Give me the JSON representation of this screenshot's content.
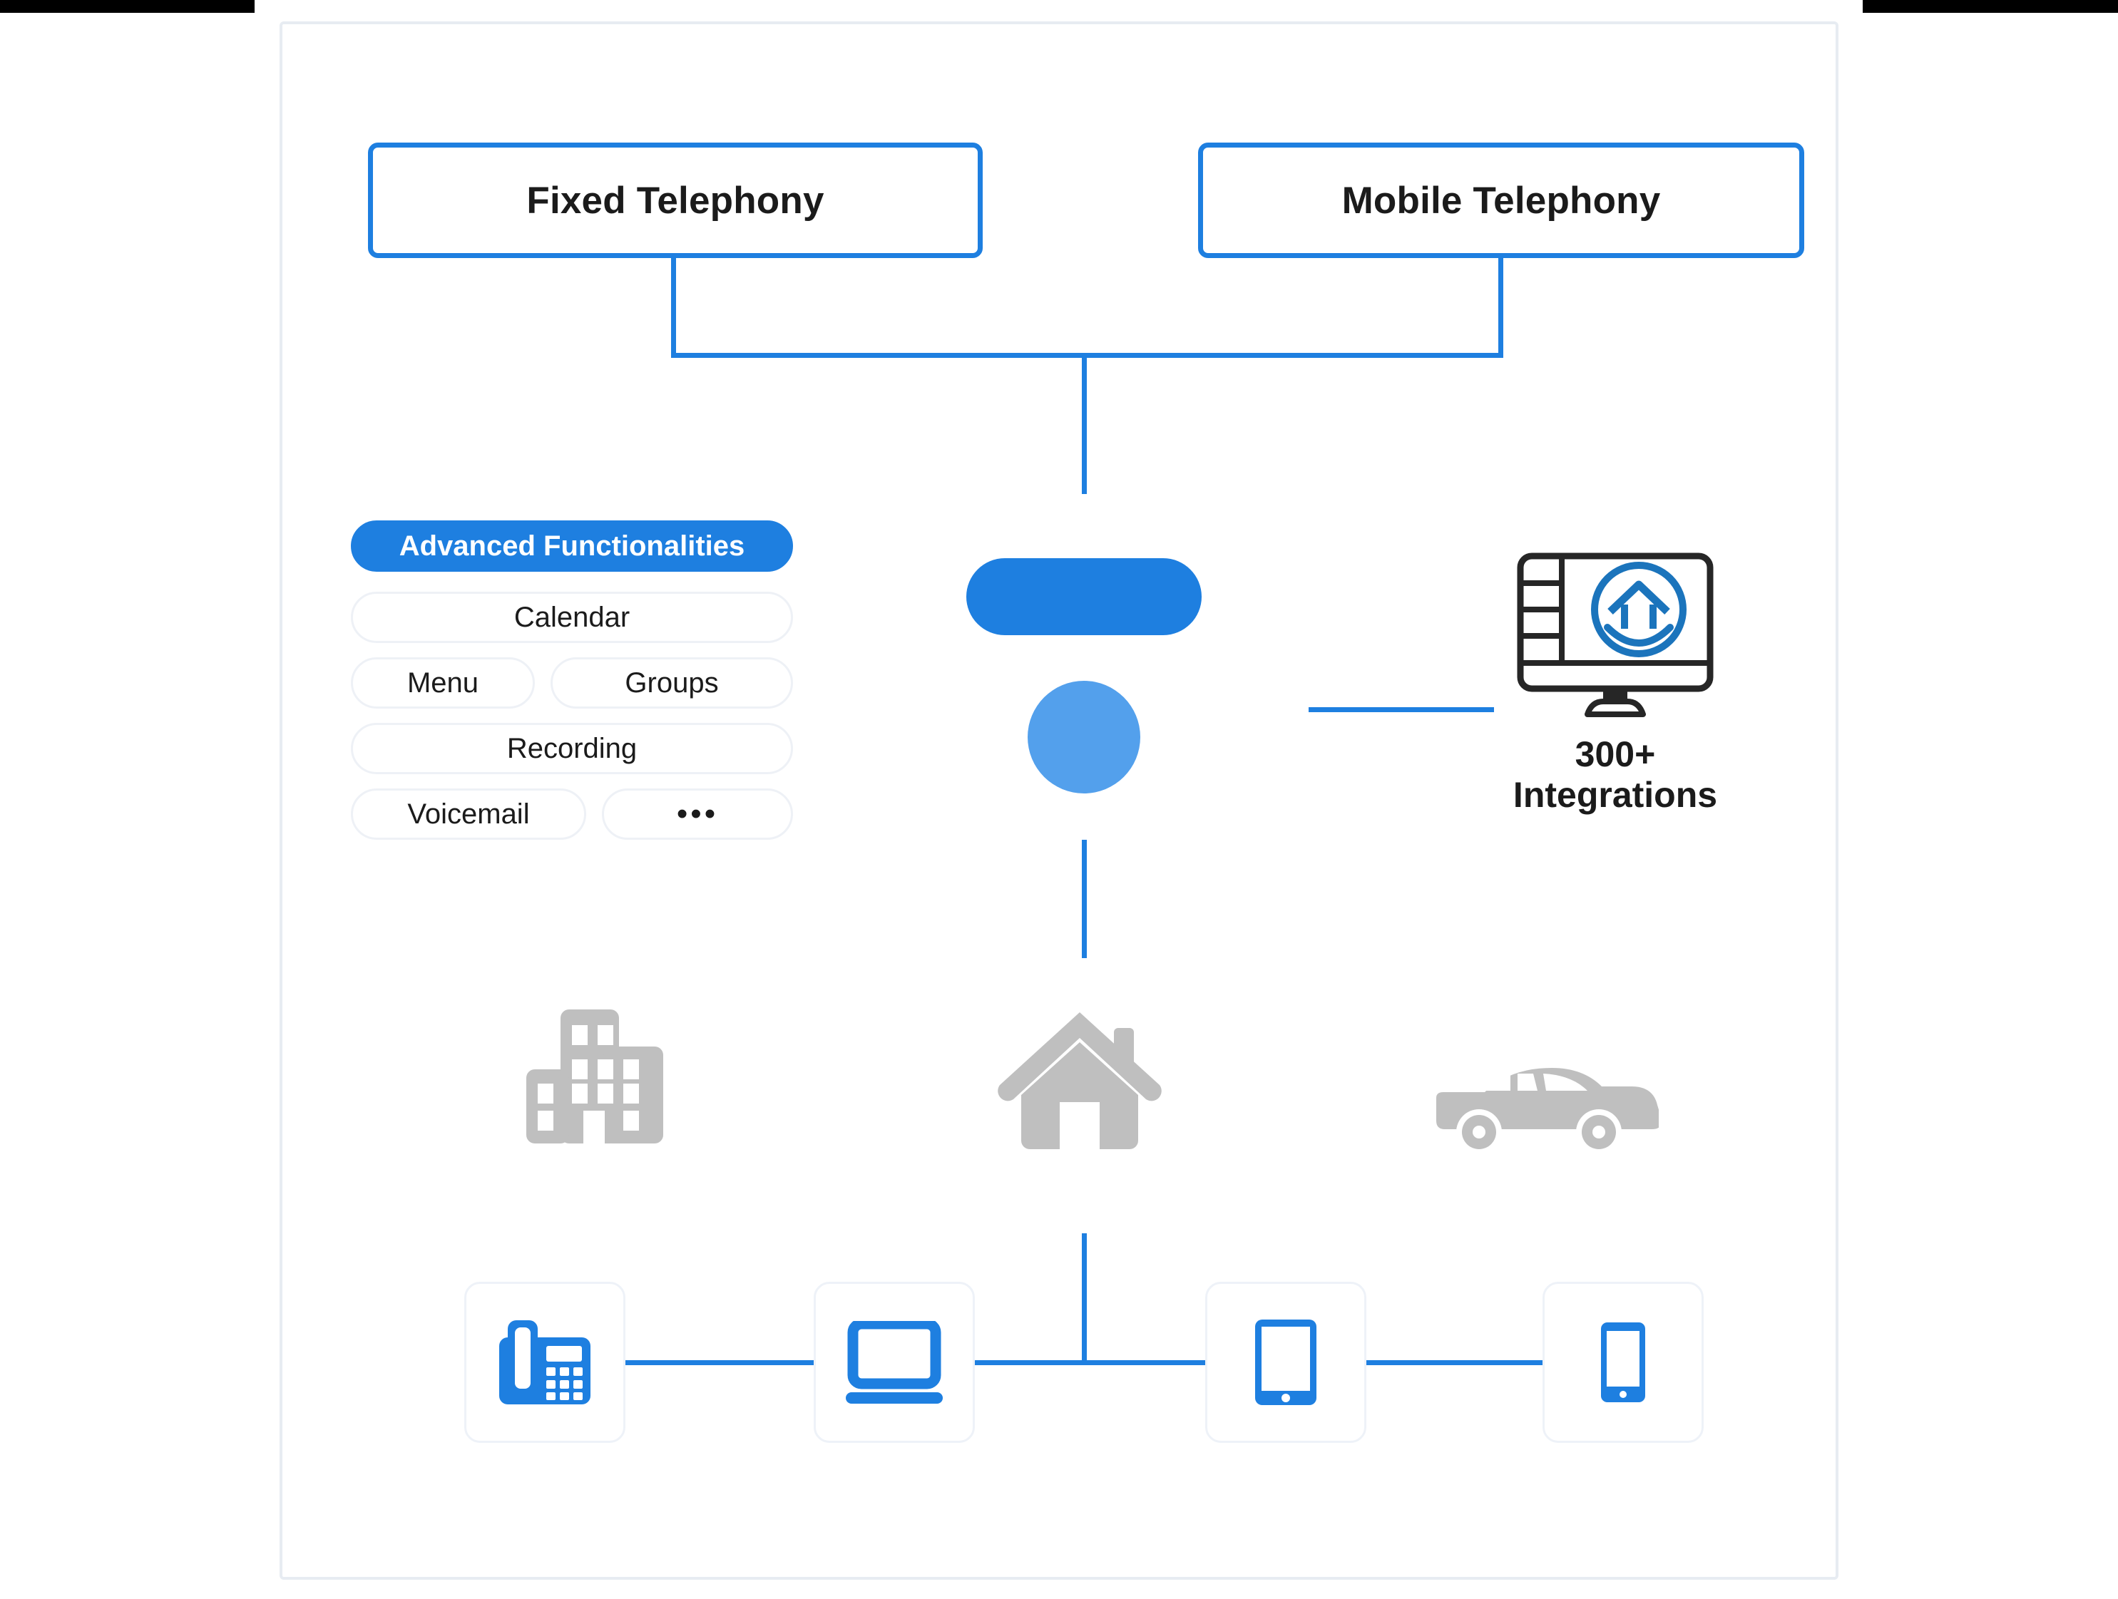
{
  "diagram": {
    "title_boxes": [
      {
        "id": "fixed",
        "label": "Fixed Telephony"
      },
      {
        "id": "mobile",
        "label": "Mobile Telephony"
      }
    ],
    "advanced_panel": {
      "header": "Advanced Functionalities",
      "rows": [
        [
          {
            "label": "Calendar"
          }
        ],
        [
          {
            "label": "Menu"
          },
          {
            "label": "Groups"
          }
        ],
        [
          {
            "label": "Recording"
          }
        ],
        [
          {
            "label": "Voicemail"
          },
          {
            "label": "•••"
          }
        ]
      ]
    },
    "integrations": {
      "count": "300+",
      "label": "Integrations",
      "icon": "monitor-home-icon"
    },
    "scene_icons": [
      {
        "name": "office-building-icon"
      },
      {
        "name": "house-icon"
      },
      {
        "name": "car-icon"
      }
    ],
    "devices": [
      {
        "name": "desk-phone-icon"
      },
      {
        "name": "laptop-icon"
      },
      {
        "name": "tablet-icon"
      },
      {
        "name": "smartphone-icon"
      }
    ],
    "colors": {
      "accent_blue": "#1E7FE0",
      "light_blue": "#53A0EC",
      "gray_icon": "#BFBFBF",
      "frame_border": "#E7ECF2",
      "pill_border": "#EEF1F6",
      "text": "#1B1B1B"
    }
  }
}
